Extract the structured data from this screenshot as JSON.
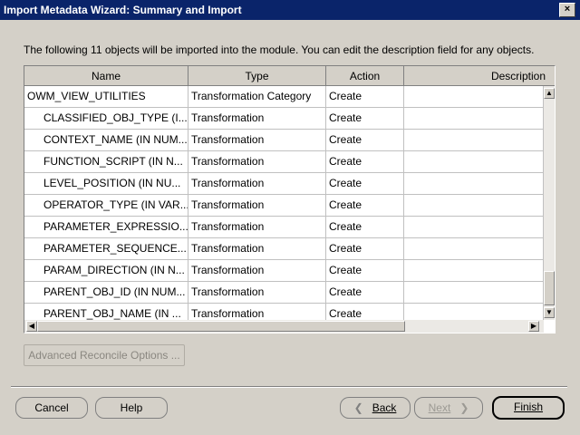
{
  "window": {
    "title": "Import Metadata Wizard: Summary and Import",
    "close_glyph": "×"
  },
  "instruction": "The following 11 objects will be imported into the module. You can edit the description field for any objects.",
  "table": {
    "columns": [
      "Name",
      "Type",
      "Action",
      "Description"
    ],
    "rows": [
      {
        "name": "OWM_VIEW_UTILITIES",
        "type": "Transformation Category",
        "action": "Create",
        "description": "",
        "child": false
      },
      {
        "name": "CLASSIFIED_OBJ_TYPE (I...",
        "type": "Transformation",
        "action": "Create",
        "description": "",
        "child": true
      },
      {
        "name": "CONTEXT_NAME (IN NUM...",
        "type": "Transformation",
        "action": "Create",
        "description": "",
        "child": true
      },
      {
        "name": "FUNCTION_SCRIPT (IN N...",
        "type": "Transformation",
        "action": "Create",
        "description": "",
        "child": true
      },
      {
        "name": "LEVEL_POSITION (IN NU...",
        "type": "Transformation",
        "action": "Create",
        "description": "",
        "child": true
      },
      {
        "name": "OPERATOR_TYPE (IN VAR...",
        "type": "Transformation",
        "action": "Create",
        "description": "",
        "child": true
      },
      {
        "name": "PARAMETER_EXPRESSIO...",
        "type": "Transformation",
        "action": "Create",
        "description": "",
        "child": true
      },
      {
        "name": "PARAMETER_SEQUENCE...",
        "type": "Transformation",
        "action": "Create",
        "description": "",
        "child": true
      },
      {
        "name": "PARAM_DIRECTION (IN N...",
        "type": "Transformation",
        "action": "Create",
        "description": "",
        "child": true
      },
      {
        "name": "PARENT_OBJ_ID (IN NUM...",
        "type": "Transformation",
        "action": "Create",
        "description": "",
        "child": true
      },
      {
        "name": "PARENT_OBJ_NAME (IN ...",
        "type": "Transformation",
        "action": "Create",
        "description": "",
        "child": true
      }
    ]
  },
  "scrollbar": {
    "up_glyph": "▲",
    "down_glyph": "▼",
    "left_glyph": "◀",
    "right_glyph": "▶"
  },
  "buttons": {
    "advanced": "Advanced Reconcile Options ...",
    "cancel": "Cancel",
    "help": "Help",
    "back_glyph": "❮",
    "back": "Back",
    "next": "Next",
    "next_glyph": "❯",
    "finish": "Finish"
  }
}
